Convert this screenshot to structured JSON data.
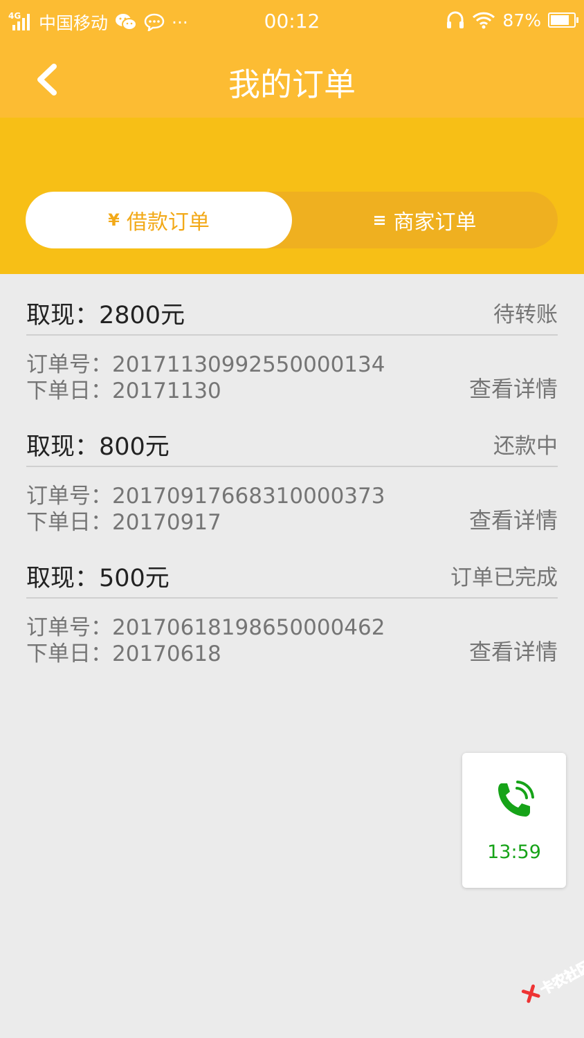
{
  "status_bar": {
    "network": "4G",
    "carrier": "中国移动",
    "more": "···",
    "time": "00:12",
    "battery": "87%"
  },
  "header": {
    "title": "我的订单",
    "back_icon": "chevron-left-icon"
  },
  "tabs": [
    {
      "icon": "¥",
      "label": "借款订单",
      "active": true
    },
    {
      "icon": "≡",
      "label": "商家订单",
      "active": false
    }
  ],
  "orders": [
    {
      "amount": "取现：2800元",
      "status": "待转账",
      "order_no": "订单号：20171130992550000134",
      "order_date": "下单日：20171130",
      "detail": "查看详情"
    },
    {
      "amount": "取现：800元",
      "status": "还款中",
      "order_no": "订单号：20170917668310000373",
      "order_date": "下单日：20170917",
      "detail": "查看详情"
    },
    {
      "amount": "取现：500元",
      "status": "订单已完成",
      "order_no": "订单号：20170618198650000462",
      "order_date": "下单日：20170618",
      "detail": "查看详情"
    }
  ],
  "call_widget": {
    "icon": "phone-ringing-icon",
    "timer": "13:59",
    "color": "#16a318"
  },
  "watermark": {
    "text": "卡农社区"
  },
  "colors": {
    "header": "#fcbc33",
    "tab_band": "#f7bf16",
    "active_tab_text": "#f2a918",
    "background": "#ebebeb"
  }
}
